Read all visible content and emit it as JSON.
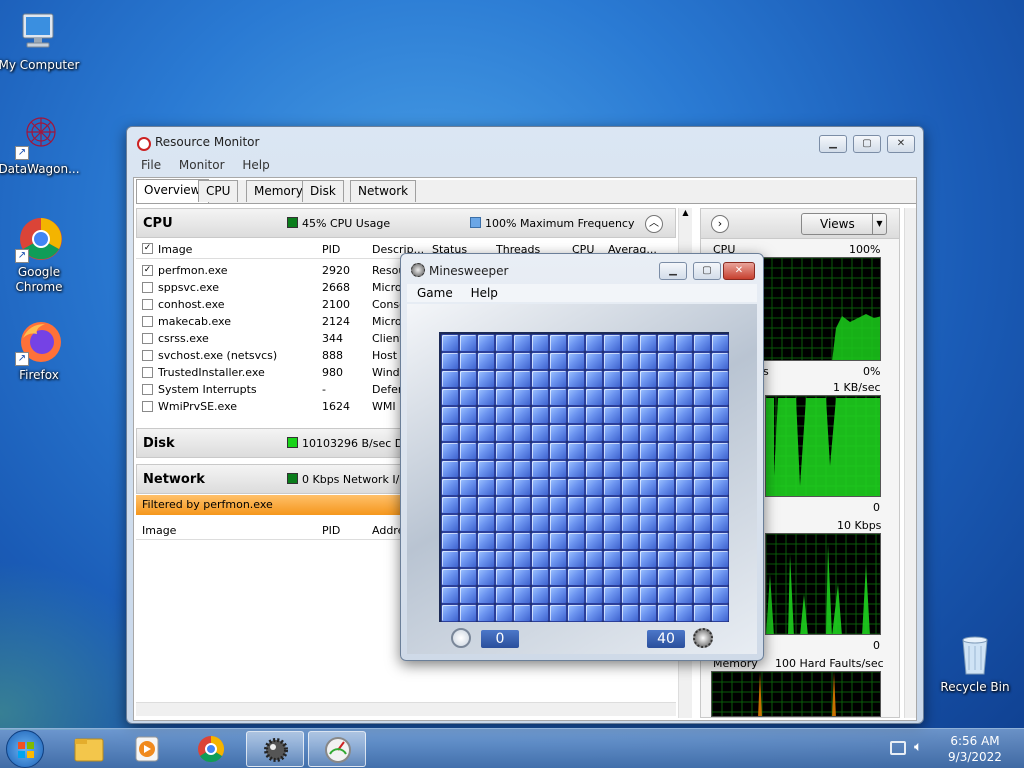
{
  "desktop": {
    "icons": [
      {
        "label": "My Computer"
      },
      {
        "label": "DataWagon..."
      },
      {
        "label": "Google Chrome"
      },
      {
        "label": "Firefox"
      },
      {
        "label": "Recycle Bin"
      }
    ]
  },
  "resmon": {
    "title": "Resource Monitor",
    "menu": [
      "File",
      "Monitor",
      "Help"
    ],
    "tabs": [
      "Overview",
      "CPU",
      "Memory",
      "Disk",
      "Network"
    ],
    "cpu": {
      "title": "CPU",
      "usage": "45% CPU Usage",
      "frequency": "100% Maximum Frequency",
      "columns": [
        "Image",
        "PID",
        "Descrip...",
        "Status",
        "Threads",
        "CPU",
        "Averag..."
      ],
      "rows": [
        {
          "image": "perfmon.exe",
          "pid": "2920",
          "desc": "Resou",
          "checked": true
        },
        {
          "image": "sppsvc.exe",
          "pid": "2668",
          "desc": "Micro",
          "checked": false
        },
        {
          "image": "conhost.exe",
          "pid": "2100",
          "desc": "Conso",
          "checked": false
        },
        {
          "image": "makecab.exe",
          "pid": "2124",
          "desc": "Micro",
          "checked": false
        },
        {
          "image": "csrss.exe",
          "pid": "344",
          "desc": "Client",
          "checked": false
        },
        {
          "image": "svchost.exe (netsvcs)",
          "pid": "888",
          "desc": "Host P",
          "checked": false
        },
        {
          "image": "TrustedInstaller.exe",
          "pid": "980",
          "desc": "Windo",
          "checked": false
        },
        {
          "image": "System Interrupts",
          "pid": "-",
          "desc": "Defer",
          "checked": false
        },
        {
          "image": "WmiPrvSE.exe",
          "pid": "1624",
          "desc": "WMI P",
          "checked": false
        }
      ]
    },
    "disk": {
      "title": "Disk",
      "status": "10103296 B/sec Dis"
    },
    "network": {
      "title": "Network",
      "status": "0 Kbps Network I/C",
      "filter": "Filtered by perfmon.exe",
      "columns": [
        "Image",
        "PID",
        "Addre"
      ]
    },
    "graphs": {
      "views_label": "Views",
      "cpu_label": "CPU",
      "cpu_max": "100%",
      "cpu_min": "0%",
      "cpu_min_prefix": "s",
      "disk_max": "1 KB/sec",
      "disk_min": "0",
      "net_max": "10 Kbps",
      "net_min": "0",
      "mem_label": "Memory",
      "mem_max": "100 Hard Faults/sec"
    }
  },
  "minesweeper": {
    "title": "Minesweeper",
    "menu": [
      "Game",
      "Help"
    ],
    "time": "0",
    "mines": "40",
    "grid_rows": 16,
    "grid_cols": 16
  },
  "taskbar": {
    "time": "6:56 AM",
    "date": "9/3/2022"
  }
}
